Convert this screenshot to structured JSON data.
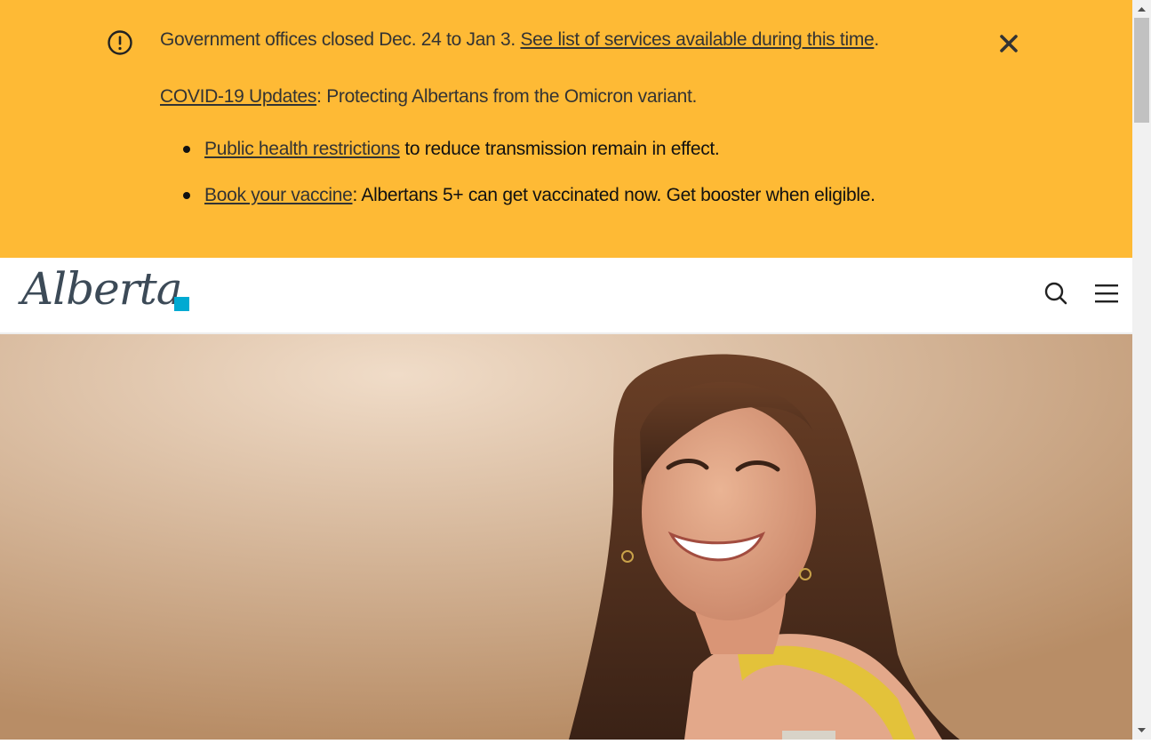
{
  "banner": {
    "notice_text": "Government offices closed Dec. 24 to Jan 3. ",
    "notice_link": "See list of services available during this time",
    "notice_end": ".",
    "covid_link": "COVID-19 Updates",
    "covid_text": ": Protecting Albertans from the Omicron variant.",
    "items": [
      {
        "link": "Public health restrictions",
        "text": " to reduce transmission remain in effect."
      },
      {
        "link": "Book your vaccine",
        "text": ": Albertans 5+ can get vaccinated now. Get booster when eligible."
      }
    ],
    "icons": {
      "alert": "exclamation-circle-icon",
      "close": "close-icon"
    },
    "background_color": "#feba35"
  },
  "header": {
    "logo_text": "Alberta",
    "accent_color": "#00aad2",
    "icons": {
      "search": "search-icon",
      "menu": "hamburger-menu-icon"
    }
  },
  "hero": {
    "image_subject": "smiling young woman with bandage on upper arm after vaccination"
  }
}
